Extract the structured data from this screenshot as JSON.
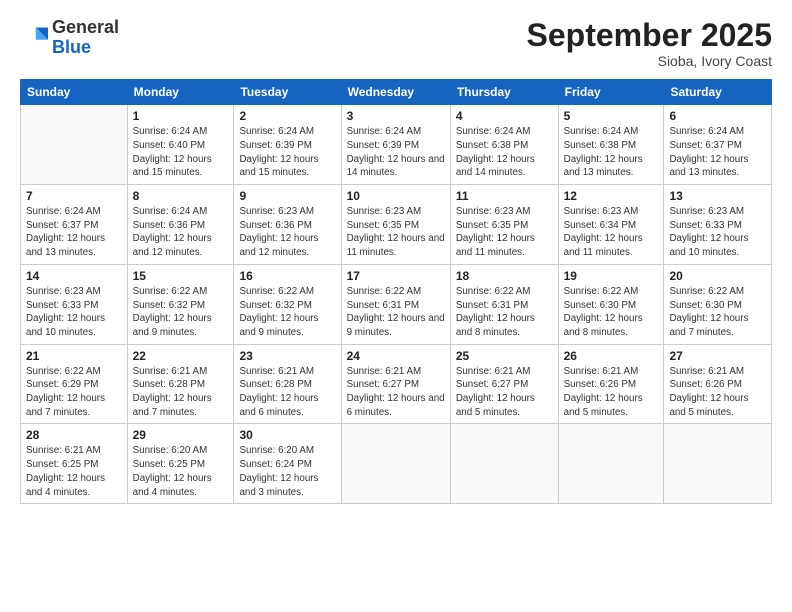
{
  "header": {
    "logo_general": "General",
    "logo_blue": "Blue",
    "month_title": "September 2025",
    "location": "Sioba, Ivory Coast"
  },
  "weekdays": [
    "Sunday",
    "Monday",
    "Tuesday",
    "Wednesday",
    "Thursday",
    "Friday",
    "Saturday"
  ],
  "weeks": [
    [
      {
        "day": "",
        "info": ""
      },
      {
        "day": "1",
        "info": "Sunrise: 6:24 AM\nSunset: 6:40 PM\nDaylight: 12 hours\nand 15 minutes."
      },
      {
        "day": "2",
        "info": "Sunrise: 6:24 AM\nSunset: 6:39 PM\nDaylight: 12 hours\nand 15 minutes."
      },
      {
        "day": "3",
        "info": "Sunrise: 6:24 AM\nSunset: 6:39 PM\nDaylight: 12 hours\nand 14 minutes."
      },
      {
        "day": "4",
        "info": "Sunrise: 6:24 AM\nSunset: 6:38 PM\nDaylight: 12 hours\nand 14 minutes."
      },
      {
        "day": "5",
        "info": "Sunrise: 6:24 AM\nSunset: 6:38 PM\nDaylight: 12 hours\nand 13 minutes."
      },
      {
        "day": "6",
        "info": "Sunrise: 6:24 AM\nSunset: 6:37 PM\nDaylight: 12 hours\nand 13 minutes."
      }
    ],
    [
      {
        "day": "7",
        "info": "Sunrise: 6:24 AM\nSunset: 6:37 PM\nDaylight: 12 hours\nand 13 minutes."
      },
      {
        "day": "8",
        "info": "Sunrise: 6:24 AM\nSunset: 6:36 PM\nDaylight: 12 hours\nand 12 minutes."
      },
      {
        "day": "9",
        "info": "Sunrise: 6:23 AM\nSunset: 6:36 PM\nDaylight: 12 hours\nand 12 minutes."
      },
      {
        "day": "10",
        "info": "Sunrise: 6:23 AM\nSunset: 6:35 PM\nDaylight: 12 hours\nand 11 minutes."
      },
      {
        "day": "11",
        "info": "Sunrise: 6:23 AM\nSunset: 6:35 PM\nDaylight: 12 hours\nand 11 minutes."
      },
      {
        "day": "12",
        "info": "Sunrise: 6:23 AM\nSunset: 6:34 PM\nDaylight: 12 hours\nand 11 minutes."
      },
      {
        "day": "13",
        "info": "Sunrise: 6:23 AM\nSunset: 6:33 PM\nDaylight: 12 hours\nand 10 minutes."
      }
    ],
    [
      {
        "day": "14",
        "info": "Sunrise: 6:23 AM\nSunset: 6:33 PM\nDaylight: 12 hours\nand 10 minutes."
      },
      {
        "day": "15",
        "info": "Sunrise: 6:22 AM\nSunset: 6:32 PM\nDaylight: 12 hours\nand 9 minutes."
      },
      {
        "day": "16",
        "info": "Sunrise: 6:22 AM\nSunset: 6:32 PM\nDaylight: 12 hours\nand 9 minutes."
      },
      {
        "day": "17",
        "info": "Sunrise: 6:22 AM\nSunset: 6:31 PM\nDaylight: 12 hours\nand 9 minutes."
      },
      {
        "day": "18",
        "info": "Sunrise: 6:22 AM\nSunset: 6:31 PM\nDaylight: 12 hours\nand 8 minutes."
      },
      {
        "day": "19",
        "info": "Sunrise: 6:22 AM\nSunset: 6:30 PM\nDaylight: 12 hours\nand 8 minutes."
      },
      {
        "day": "20",
        "info": "Sunrise: 6:22 AM\nSunset: 6:30 PM\nDaylight: 12 hours\nand 7 minutes."
      }
    ],
    [
      {
        "day": "21",
        "info": "Sunrise: 6:22 AM\nSunset: 6:29 PM\nDaylight: 12 hours\nand 7 minutes."
      },
      {
        "day": "22",
        "info": "Sunrise: 6:21 AM\nSunset: 6:28 PM\nDaylight: 12 hours\nand 7 minutes."
      },
      {
        "day": "23",
        "info": "Sunrise: 6:21 AM\nSunset: 6:28 PM\nDaylight: 12 hours\nand 6 minutes."
      },
      {
        "day": "24",
        "info": "Sunrise: 6:21 AM\nSunset: 6:27 PM\nDaylight: 12 hours\nand 6 minutes."
      },
      {
        "day": "25",
        "info": "Sunrise: 6:21 AM\nSunset: 6:27 PM\nDaylight: 12 hours\nand 5 minutes."
      },
      {
        "day": "26",
        "info": "Sunrise: 6:21 AM\nSunset: 6:26 PM\nDaylight: 12 hours\nand 5 minutes."
      },
      {
        "day": "27",
        "info": "Sunrise: 6:21 AM\nSunset: 6:26 PM\nDaylight: 12 hours\nand 5 minutes."
      }
    ],
    [
      {
        "day": "28",
        "info": "Sunrise: 6:21 AM\nSunset: 6:25 PM\nDaylight: 12 hours\nand 4 minutes."
      },
      {
        "day": "29",
        "info": "Sunrise: 6:20 AM\nSunset: 6:25 PM\nDaylight: 12 hours\nand 4 minutes."
      },
      {
        "day": "30",
        "info": "Sunrise: 6:20 AM\nSunset: 6:24 PM\nDaylight: 12 hours\nand 3 minutes."
      },
      {
        "day": "",
        "info": ""
      },
      {
        "day": "",
        "info": ""
      },
      {
        "day": "",
        "info": ""
      },
      {
        "day": "",
        "info": ""
      }
    ]
  ]
}
